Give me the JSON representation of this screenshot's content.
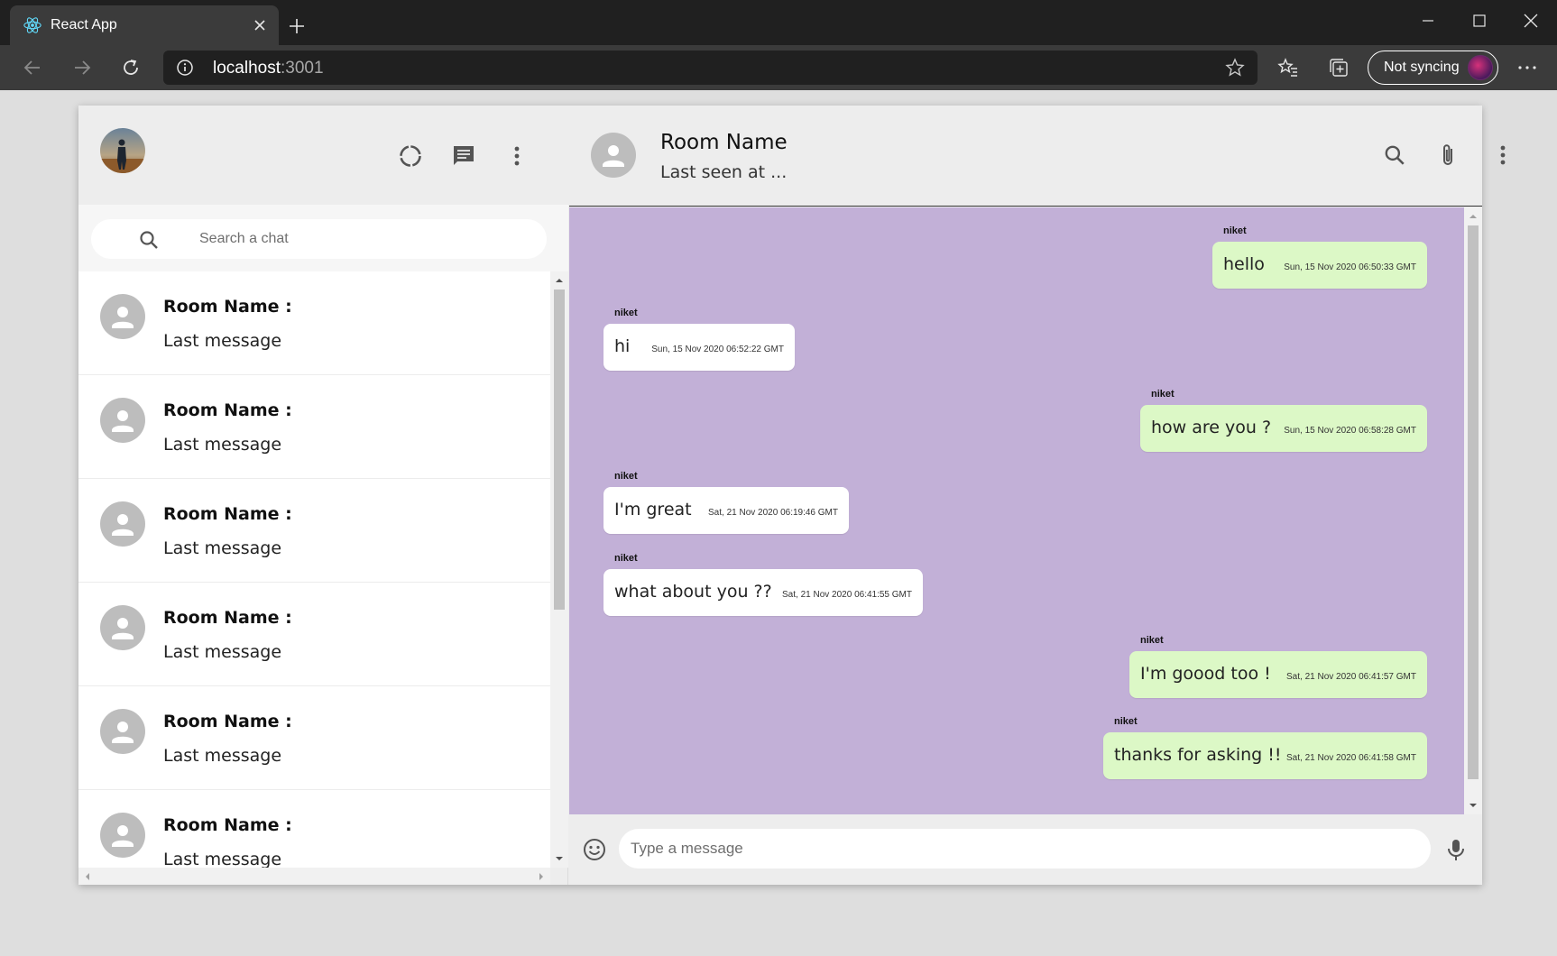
{
  "browser": {
    "tab_title": "React App",
    "url_host": "localhost",
    "url_port": ":3001",
    "sync_label": "Not syncing"
  },
  "sidebar": {
    "search_placeholder": "Search a chat",
    "chats": [
      {
        "title": "Room Name :",
        "last_message": "Last message"
      },
      {
        "title": "Room Name :",
        "last_message": "Last message"
      },
      {
        "title": "Room Name :",
        "last_message": "Last message"
      },
      {
        "title": "Room Name :",
        "last_message": "Last message"
      },
      {
        "title": "Room Name :",
        "last_message": "Last message"
      },
      {
        "title": "Room Name :",
        "last_message": "Last message"
      }
    ]
  },
  "chat": {
    "room_name": "Room Name",
    "last_seen": "Last seen at ...",
    "composer_placeholder": "Type a message",
    "messages": [
      {
        "name": "niket",
        "text": "hello",
        "time": "Sun, 15 Nov 2020 06:50:33 GMT",
        "sent": true
      },
      {
        "name": "niket",
        "text": "hi",
        "time": "Sun, 15 Nov 2020 06:52:22 GMT",
        "sent": false
      },
      {
        "name": "niket",
        "text": "how are you ?",
        "time": "Sun, 15 Nov 2020 06:58:28 GMT",
        "sent": true
      },
      {
        "name": "niket",
        "text": "I'm great",
        "time": "Sat, 21 Nov 2020 06:19:46 GMT",
        "sent": false
      },
      {
        "name": "niket",
        "text": "what about you ??",
        "time": "Sat, 21 Nov 2020 06:41:55 GMT",
        "sent": false
      },
      {
        "name": "niket",
        "text": "I'm goood too !",
        "time": "Sat, 21 Nov 2020 06:41:57 GMT",
        "sent": true
      },
      {
        "name": "niket",
        "text": "thanks for asking !!",
        "time": "Sat, 21 Nov 2020 06:41:58 GMT",
        "sent": true
      }
    ]
  },
  "colors": {
    "chat_background": "#c2b0d7",
    "sent_bubble": "#dcf8c6",
    "received_bubble": "#ffffff"
  }
}
